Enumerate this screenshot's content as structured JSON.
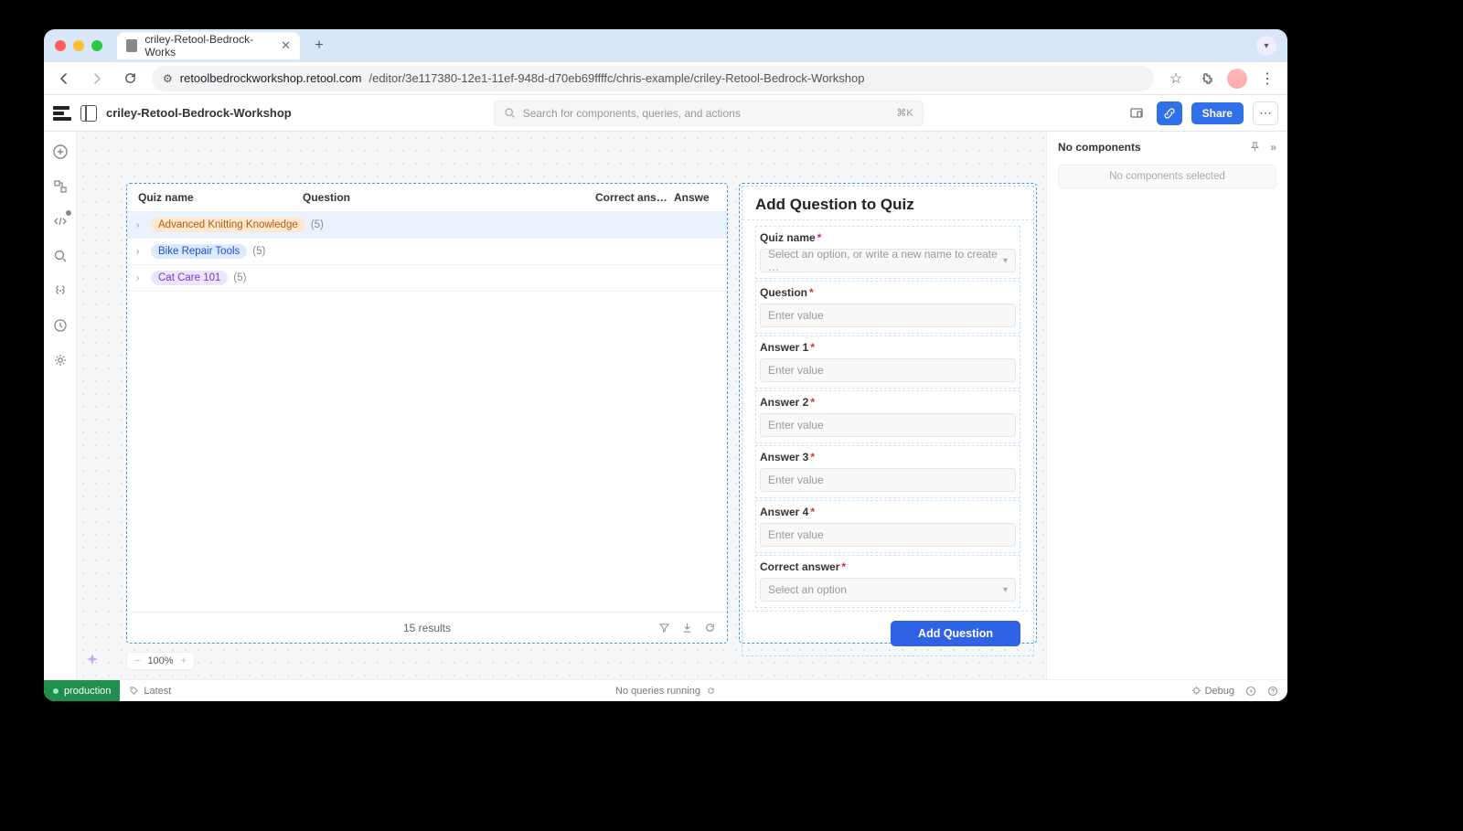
{
  "browser": {
    "tab_title": "criley-Retool-Bedrock-Works",
    "url_domain": "retoolbedrockworkshop.retool.com",
    "url_path": "/editor/3e117380-12e1-11ef-948d-d70eb69ffffc/chris-example/criley-Retool-Bedrock-Workshop"
  },
  "appbar": {
    "app_name": "criley-Retool-Bedrock-Workshop",
    "search_placeholder": "Search for components, queries, and actions",
    "search_shortcut": "⌘K",
    "share": "Share"
  },
  "table": {
    "headers": {
      "c1": "Quiz name",
      "c2": "Question",
      "c3": "Correct ans…",
      "c4": "Answe"
    },
    "rows": [
      {
        "name": "Advanced Knitting Knowledge",
        "count": "(5)",
        "pill": "orange",
        "selected": true
      },
      {
        "name": "Bike Repair Tools",
        "count": "(5)",
        "pill": "blue",
        "selected": false
      },
      {
        "name": "Cat Care 101",
        "count": "(5)",
        "pill": "purple",
        "selected": false
      }
    ],
    "footer_results": "15 results"
  },
  "form": {
    "title": "Add Question to Quiz",
    "quiz_name_label": "Quiz name",
    "quiz_name_placeholder": "Select an option, or write a new name to create …",
    "question_label": "Question",
    "answer1_label": "Answer 1",
    "answer2_label": "Answer 2",
    "answer3_label": "Answer 3",
    "answer4_label": "Answer 4",
    "correct_label": "Correct answer",
    "enter_value": "Enter value",
    "select_option": "Select an option",
    "submit": "Add Question"
  },
  "right_panel": {
    "title": "No components",
    "empty": "No components selected"
  },
  "zoom": {
    "value": "100%"
  },
  "status": {
    "env": "production",
    "latest": "Latest",
    "queries": "No queries running",
    "debug": "Debug"
  }
}
